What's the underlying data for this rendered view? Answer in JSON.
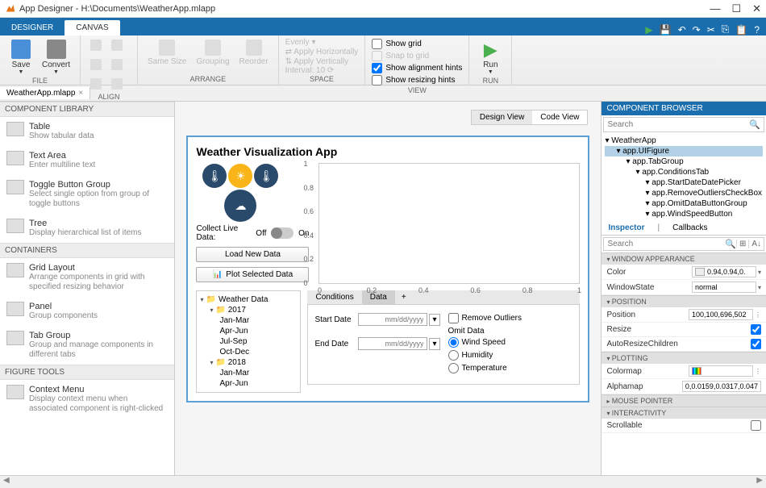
{
  "window": {
    "app_name": "App Designer",
    "file_path": "H:\\Documents\\WeatherApp.mlapp"
  },
  "ribbon": {
    "tabs": [
      "DESIGNER",
      "CANVAS"
    ],
    "active_tab": "CANVAS",
    "groups": {
      "file": {
        "save": "Save",
        "convert": "Convert",
        "label": "FILE"
      },
      "align": {
        "items": [
          "Align Left",
          "Align Center",
          "Align Right",
          "Align Top",
          "Align Mid",
          "Align Btm"
        ],
        "label": "ALIGN"
      },
      "arrange": {
        "same": "Same Size",
        "group": "Grouping",
        "reorder": "Reorder",
        "label": "ARRANGE"
      },
      "space": {
        "evenly": "Evenly",
        "apply_h": "Apply Horizontally",
        "apply_v": "Apply Vertically",
        "interval_label": "Interval:",
        "interval_val": "10",
        "label": "SPACE"
      },
      "view": {
        "show_grid": "Show grid",
        "snap": "Snap to grid",
        "show_align": "Show alignment hints",
        "show_resize": "Show resizing hints",
        "label": "VIEW"
      },
      "run": {
        "run": "Run",
        "label": "RUN"
      }
    }
  },
  "doc_tab": "WeatherApp.mlapp",
  "library": {
    "header": "COMPONENT LIBRARY",
    "items": [
      {
        "title": "Table",
        "desc": "Show tabular data"
      },
      {
        "title": "Text Area",
        "desc": "Enter multiline text"
      },
      {
        "title": "Toggle Button Group",
        "desc": "Select single option from group of toggle buttons"
      },
      {
        "title": "Tree",
        "desc": "Display hierarchical list of items"
      }
    ],
    "containers_hdr": "CONTAINERS",
    "containers": [
      {
        "title": "Grid Layout",
        "desc": "Arrange components in grid with specified resizing behavior"
      },
      {
        "title": "Panel",
        "desc": "Group components"
      },
      {
        "title": "Tab Group",
        "desc": "Group and manage components in different tabs"
      }
    ],
    "figtools_hdr": "FIGURE TOOLS",
    "figtools": [
      {
        "title": "Context Menu",
        "desc": "Display context menu when associated component is right-clicked"
      }
    ]
  },
  "view_toggle": {
    "design": "Design View",
    "code": "Code View"
  },
  "app": {
    "title": "Weather Visualization App",
    "collect_label": "Collect Live Data:",
    "off": "Off",
    "on": "On",
    "load_btn": "Load New Data",
    "plot_btn": "Plot Selected Data",
    "tree_root": "Weather Data",
    "tree_years": [
      "2017",
      "2018"
    ],
    "tree_q": [
      "Jan-Mar",
      "Apr-Jun",
      "Jul-Sep",
      "Oct-Dec"
    ],
    "tabs": [
      "Conditions",
      "Data"
    ],
    "start_date": "Start Date",
    "end_date": "End Date",
    "date_placeholder": "mm/dd/yyyy",
    "remove_outliers": "Remove Outliers",
    "omit_label": "Omit Data",
    "omit_opts": [
      "Wind Speed",
      "Humidity",
      "Temperature"
    ]
  },
  "chart_data": {
    "type": "line",
    "title": "",
    "xlabel": "",
    "ylabel": "",
    "xlim": [
      0,
      1
    ],
    "ylim": [
      0,
      1
    ],
    "xticks": [
      0,
      0.2,
      0.4,
      0.6,
      0.8,
      1
    ],
    "yticks": [
      0,
      0.2,
      0.4,
      0.6,
      0.8,
      1
    ],
    "series": []
  },
  "browser": {
    "header": "COMPONENT BROWSER",
    "search_ph": "Search",
    "tree": [
      {
        "lvl": 0,
        "label": "WeatherApp"
      },
      {
        "lvl": 1,
        "label": "app.UIFigure",
        "sel": true
      },
      {
        "lvl": 2,
        "label": "app.TabGroup"
      },
      {
        "lvl": 3,
        "label": "app.ConditionsTab"
      },
      {
        "lvl": 4,
        "label": "app.StartDateDatePicker"
      },
      {
        "lvl": 4,
        "label": "app.RemoveOutliersCheckBox"
      },
      {
        "lvl": 4,
        "label": "app.OmitDataButtonGroup"
      },
      {
        "lvl": 4,
        "label": "app.WindSpeedButton"
      }
    ],
    "insp_tabs": [
      "Inspector",
      "Callbacks"
    ],
    "sections": {
      "window_app": "WINDOW APPEARANCE",
      "position": "POSITION",
      "plotting": "PLOTTING",
      "mouse": "MOUSE POINTER",
      "interact": "INTERACTIVITY"
    },
    "props": {
      "color_name": "Color",
      "color_val": "0.94,0.94,0.",
      "winstate_name": "WindowState",
      "winstate_val": "normal",
      "pos_name": "Position",
      "pos_val": "100,100,696,502",
      "resize_name": "Resize",
      "resize_chk": true,
      "auto_name": "AutoResizeChildren",
      "auto_chk": true,
      "cmap_name": "Colormap",
      "alpha_name": "Alphamap",
      "alpha_val": "0,0.0159,0.0317,0.047",
      "scroll_name": "Scrollable",
      "scroll_chk": false
    }
  }
}
